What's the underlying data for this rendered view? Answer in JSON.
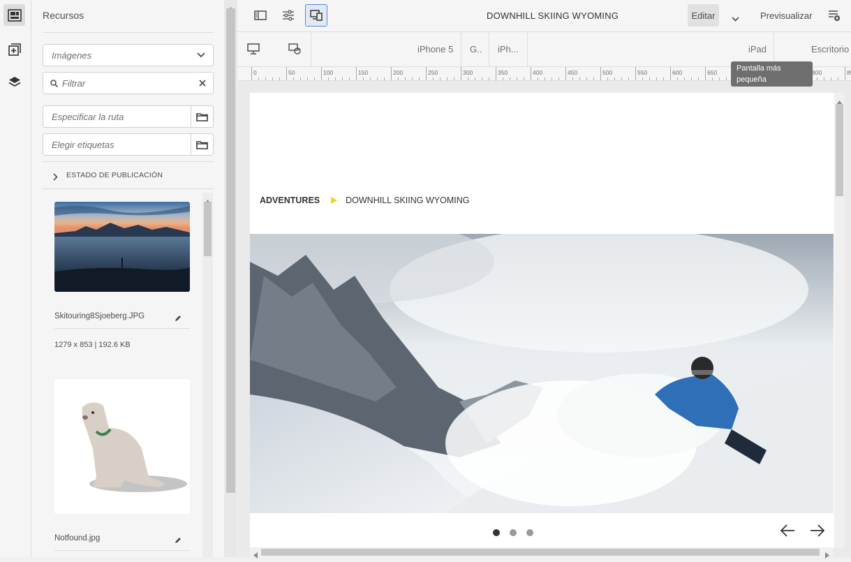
{
  "panel": {
    "title": "Recursos",
    "asset_type": "Imágenes",
    "filter_placeholder": "Filtrar",
    "path_placeholder": "Especificar la ruta",
    "tags_placeholder": "Elegir etiquetas",
    "publication_status": "ESTADO DE PUBLICACIÓN",
    "assets": [
      {
        "name": "Skitouring8Sjoeberg.JPG",
        "meta": "1279 x 853 | 192.6 KB"
      },
      {
        "name": "Notfound.jpg"
      }
    ]
  },
  "toolbar": {
    "page_title": "DOWNHILL SKIING WYOMING",
    "edit_label": "Editar",
    "preview_label": "Previsualizar"
  },
  "emulator": {
    "devices": [
      "iPhone 5",
      "G..",
      "iPh...",
      "iPad",
      "Escritorio"
    ],
    "tooltip": "Pantalla más pequeña"
  },
  "ruler": {
    "labels": [
      "0",
      "50",
      "100",
      "150",
      "200",
      "250",
      "300",
      "350",
      "400",
      "450",
      "500",
      "550",
      "600",
      "650",
      "700",
      "750",
      "800",
      "850"
    ]
  },
  "page": {
    "breadcrumb_parent": "ADVENTURES",
    "breadcrumb_current": "DOWNHILL SKIING WYOMING",
    "carousel": {
      "slides": 3,
      "active": 0
    }
  },
  "colors": {
    "accent": "#4a8ce0",
    "breadcrumb_arrow": "#f2d21b",
    "tooltip_bg": "#6e6e6e"
  }
}
